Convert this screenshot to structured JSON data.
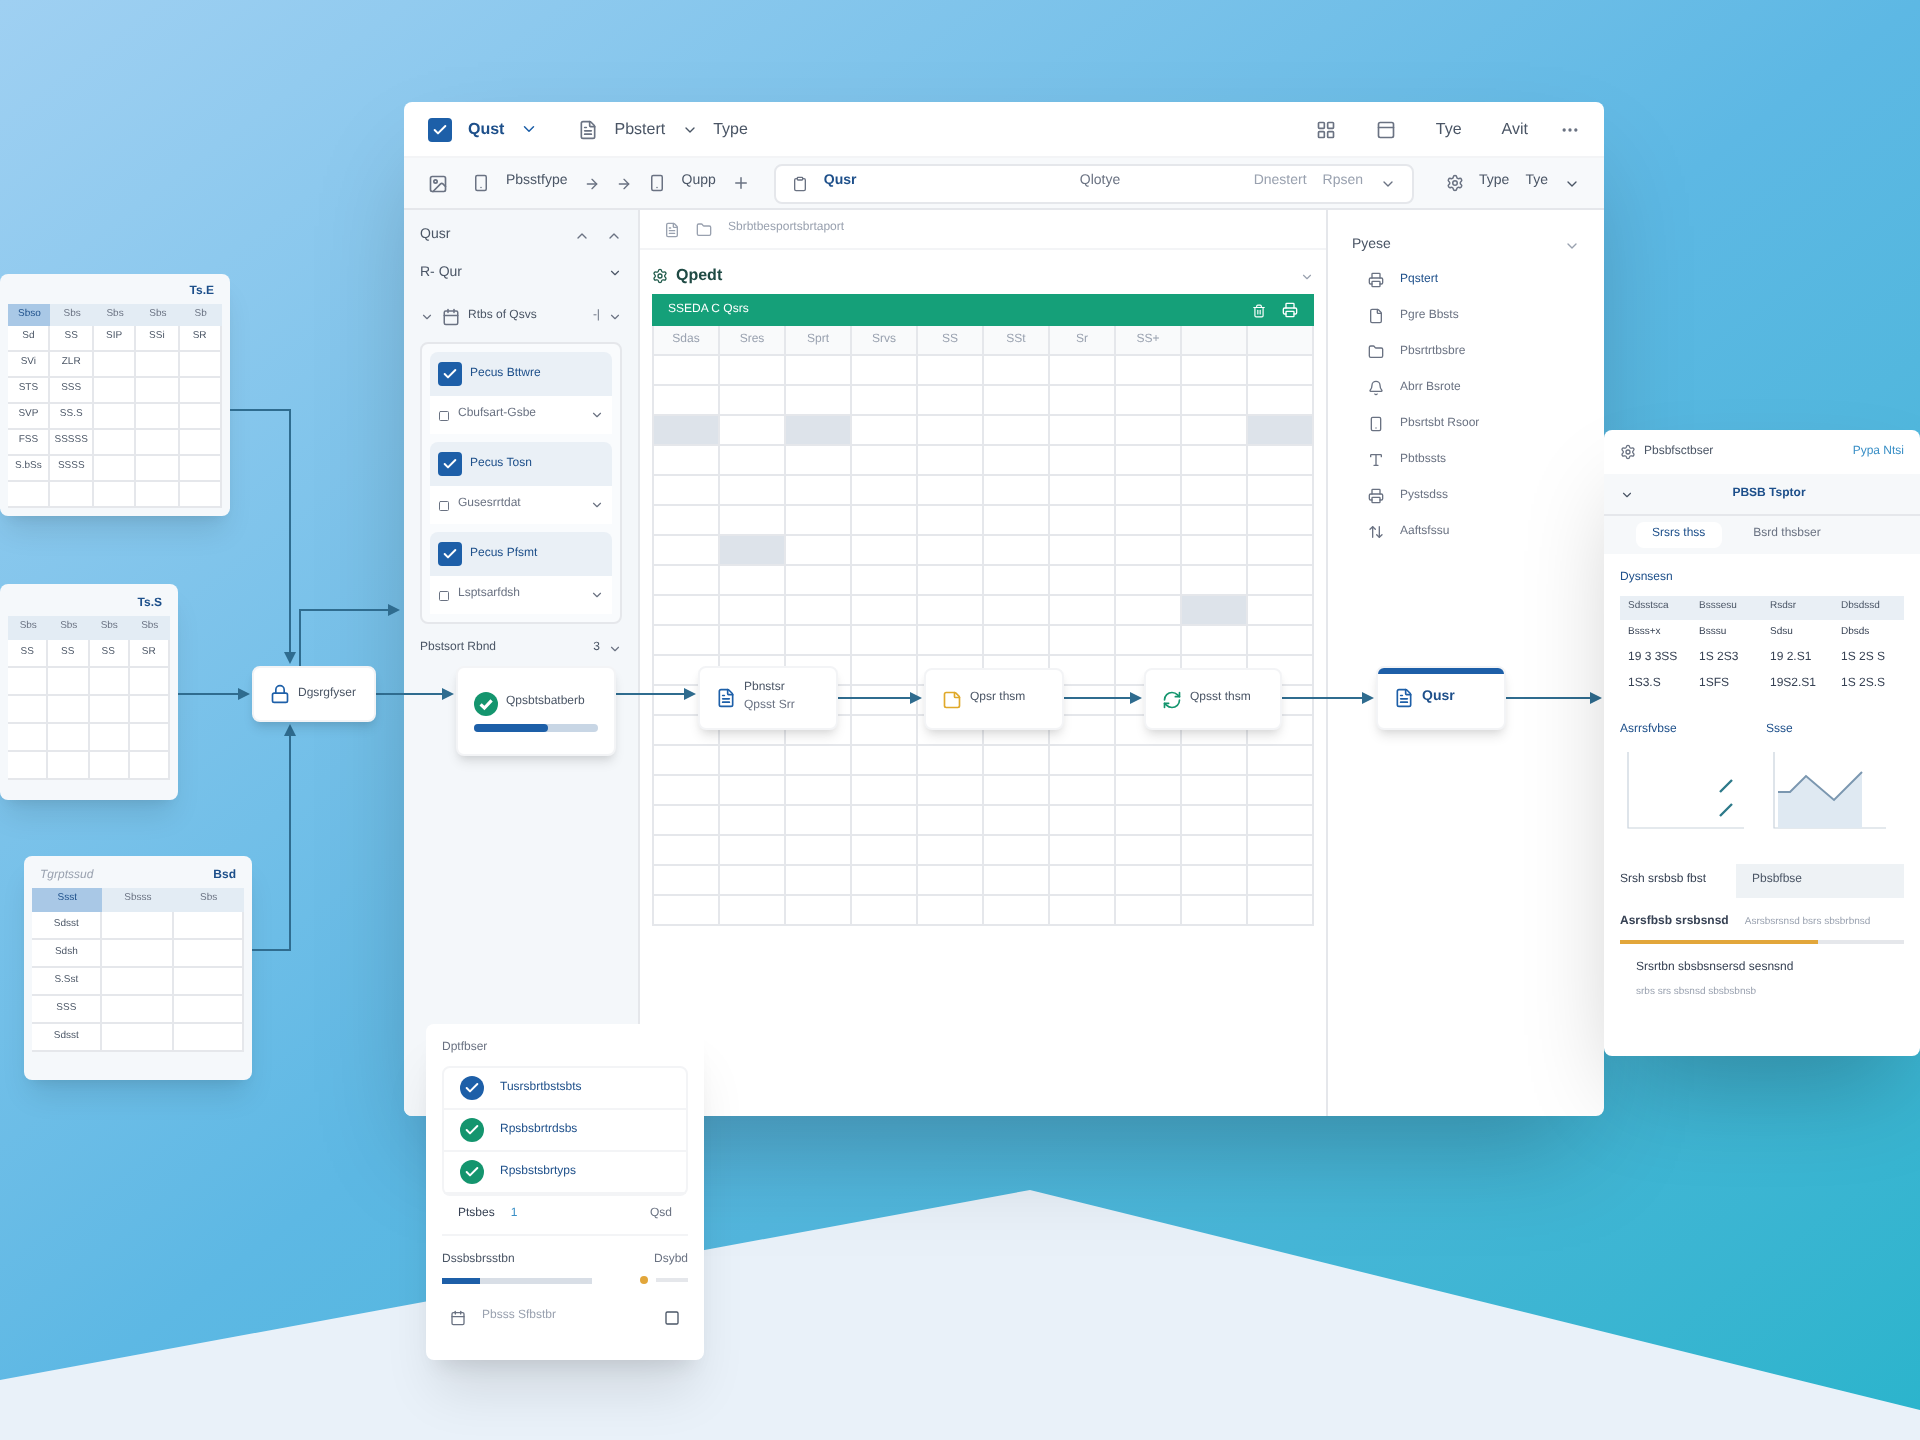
{
  "main_window": {
    "toolbar": {
      "checked": true,
      "title": "Qust",
      "menu_1": "Pbstert",
      "menu_2": "Type",
      "right_items": [
        "Tye",
        "Avit"
      ]
    },
    "toolbar_2": {
      "label_1": "Pbsstfype",
      "label_2": "Qupp",
      "search": "Qusr",
      "field_items": [
        "Qlotye",
        "Dnestert",
        "Rpsen"
      ],
      "right_items": [
        "Type",
        "Tye"
      ]
    },
    "left_panel": {
      "title": "Qusr",
      "dropdown": "R- Qur",
      "tree_item": "Rtbs of Qsvs",
      "tree_mark": "-|",
      "cards": [
        {
          "title": "Pecus Bttwre",
          "checked": true,
          "select": "Cbufsart-Gsbe"
        },
        {
          "title": "Pecus Tosn",
          "checked": true,
          "select": "Gusesrrtdat"
        },
        {
          "title": "Pecus Pfsmt",
          "checked": true,
          "select": "Lsptsarfdsh"
        }
      ],
      "footer": "Pbstsort Rbnd",
      "footer_count": "3"
    },
    "center": {
      "breadcrumb": "Sbrbtbesportsbrtaport",
      "title": "Qpedt",
      "bar_title": "SSEDA C Qsrs",
      "columns": [
        "Sdas",
        "Sres",
        "Sprt",
        "Srvs",
        "SS",
        "SSt",
        "Sr",
        "SS+"
      ],
      "rows": [
        [
          false,
          false,
          false,
          false,
          false,
          false,
          false,
          false,
          false,
          false
        ],
        [
          false,
          false,
          false,
          false,
          false,
          false,
          false,
          false,
          false,
          false
        ],
        [
          true,
          false,
          true,
          false,
          false,
          false,
          false,
          false,
          false,
          true
        ],
        [
          false,
          false,
          false,
          false,
          false,
          false,
          false,
          false,
          false,
          false
        ],
        [
          false,
          false,
          false,
          false,
          false,
          false,
          false,
          false,
          false,
          false
        ],
        [
          false,
          false,
          false,
          false,
          false,
          false,
          false,
          false,
          false,
          false
        ],
        [
          false,
          true,
          false,
          false,
          false,
          false,
          false,
          false,
          false,
          false
        ],
        [
          false,
          false,
          false,
          false,
          false,
          false,
          false,
          false,
          false,
          false
        ],
        [
          false,
          false,
          false,
          false,
          false,
          false,
          false,
          false,
          true,
          false
        ],
        [
          false,
          false,
          false,
          false,
          false,
          false,
          false,
          false,
          false,
          false
        ]
      ]
    },
    "right_panel": {
      "title": "Pyese",
      "items": [
        "Pqstert",
        "Pgre Bbsts",
        "Pbsrtrtbsbre",
        "Abrr Bsrote",
        "Pbsrtsbt Rsoor",
        "Pbtbssts",
        "Pystsdss",
        "Aaftsfssu"
      ]
    }
  },
  "flow_nodes": [
    {
      "kind": "lock",
      "label": "Dgsrgfyser",
      "selected": false
    },
    {
      "kind": "check",
      "label": "Qpsbtsbatberb",
      "selected": false,
      "level": 0.6
    },
    {
      "kind": "doc",
      "label": "Pbnstsr",
      "sublabel": "Qpsst Srr",
      "selected": false
    },
    {
      "kind": "note",
      "label": "Qpsr thsm",
      "selected": false
    },
    {
      "kind": "cycle",
      "label": "Qpsst thsm",
      "selected": false
    },
    {
      "kind": "doc",
      "label": "Qusr",
      "selected": true
    }
  ],
  "side_tables": [
    {
      "title": "Ts.E",
      "columns": [
        {
          "label": "Sbso",
          "selected": true
        },
        {
          "label": "Sbs",
          "selected": false
        },
        {
          "label": "Sbs",
          "selected": false
        },
        {
          "label": "Sbs",
          "selected": false
        },
        {
          "label": "Sb",
          "selected": false
        }
      ],
      "rows": [
        [
          "Sd",
          "SS",
          "SIP",
          "SSi",
          "SR"
        ],
        [
          "SVi",
          "ZLR"
        ],
        [
          "STS",
          "SSS"
        ],
        [
          "SVP",
          "SS.S"
        ],
        [
          "FSS",
          "SSSSS"
        ],
        [
          "S.bSs",
          "SSSS"
        ]
      ]
    },
    {
      "title": "Ts.S",
      "columns": [
        {
          "label": "Sbs",
          "selected": false
        },
        {
          "label": "Sbs",
          "selected": false
        },
        {
          "label": "Sbs",
          "selected": false
        },
        {
          "label": "Sbs",
          "selected": false
        }
      ],
      "rows": [
        [
          "SS",
          "SS",
          "SS",
          "SR"
        ]
      ]
    },
    {
      "title": "Tgrptssud",
      "action": "Bsd",
      "columns": [
        {
          "label": "Ssst",
          "selected": true
        },
        {
          "label": "Sbsss",
          "selected": false
        },
        {
          "label": "Sbs",
          "selected": false
        }
      ],
      "rows": [
        [
          "Sdsst"
        ],
        [
          "Sdsh"
        ],
        [
          "S.Sst"
        ],
        [
          "SSS"
        ],
        [
          "Sdsst"
        ]
      ]
    }
  ],
  "report_card": {
    "title": "Pbsbfsctbser",
    "link": "Pypa Ntsi",
    "section": "PBSB Tsptor",
    "tabs": [
      {
        "label": "Srsrs thss",
        "selected": true
      },
      {
        "label": "Bsrd thsbser",
        "selected": false
      }
    ],
    "table_title": "Dysnsesn",
    "columns": [
      "Sdsstsca",
      "Bsssesu",
      "Rsdsr",
      "Dbsdssd"
    ],
    "rows": [
      [
        "Bsss+x",
        "Bsssu",
        "Sdsu",
        "Dbsds"
      ],
      [
        "19 3 3SS",
        "1S 2S3",
        "19 2.S1",
        "1S 2S S"
      ],
      [
        "1S3.S",
        "1SFS",
        "19S2.S1",
        "1S 2S.S"
      ]
    ],
    "chart_titles": [
      "Asrrsfvbse",
      "Ssse"
    ],
    "field_label": "Srsh srsbsb fbst",
    "field_value": "Pbsbfbse",
    "progress_label": "Asrsfbsb srsbsnsd",
    "progress_note": "Asrsbsrsnsd bsrs sbsbrbnsd",
    "level": 0.7,
    "note": "Srsrtbn sbsbsnsersd sesnsnd",
    "note_2": "srbs srs sbsnsd sbsbsbnsb"
  },
  "task_card": {
    "title": "Dptfbser",
    "items": [
      {
        "label": "Tusrsbrtbstsbts",
        "checked": true,
        "color": "#1d5fa8"
      },
      {
        "label": "Rpsbsbrtrdsbs",
        "checked": true,
        "color": "#14956e"
      },
      {
        "label": "Rpsbstsbrtyps",
        "checked": true,
        "color": "#14956e"
      }
    ],
    "row_label": "Ptsbes",
    "row_count": "1",
    "row_value": "Qsd",
    "progress_label": "Dssbsbrsstbn",
    "progress_value": "Dsybd",
    "level": 0.25,
    "footer": "Pbsss Sfbstbr"
  }
}
